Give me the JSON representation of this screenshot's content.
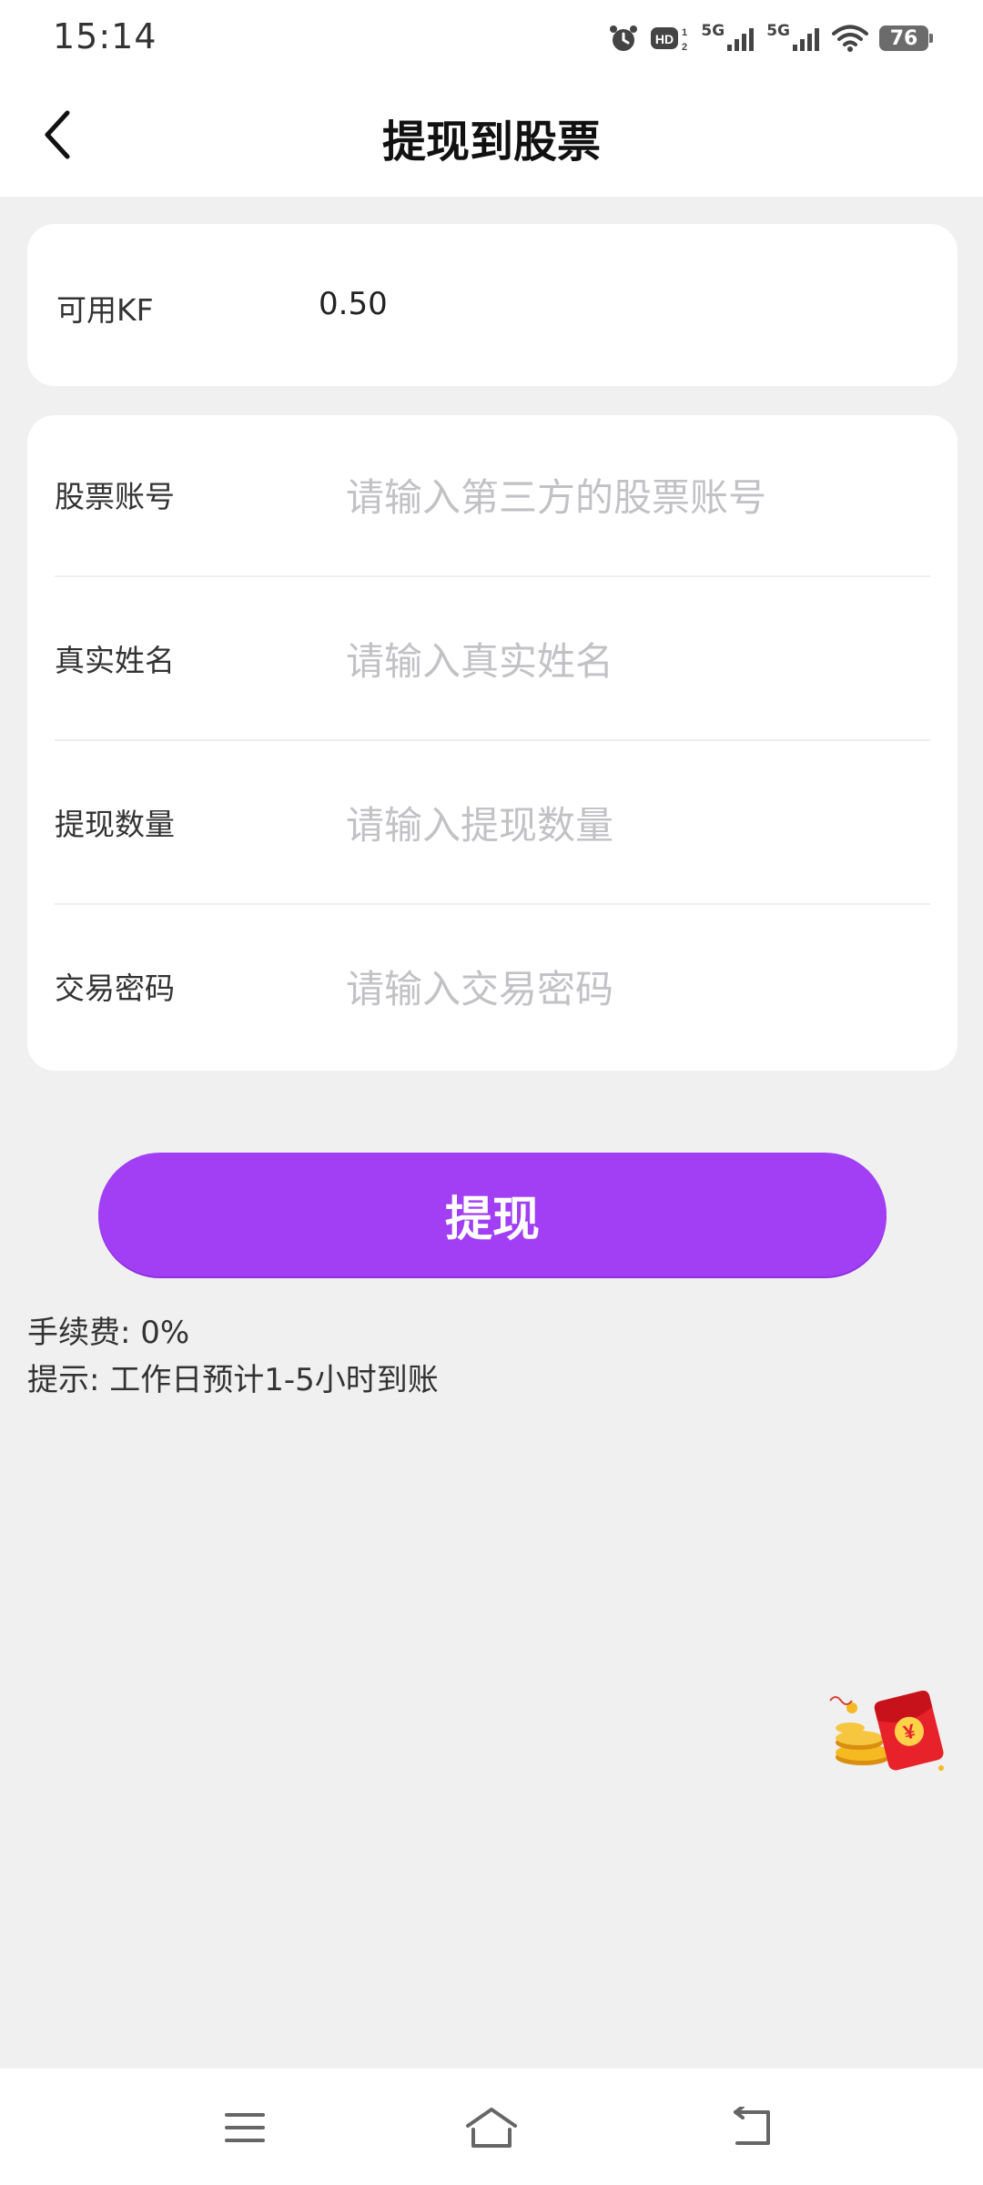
{
  "status_bar": {
    "time": "15:14",
    "icons": [
      "alarm-icon",
      "hd-call-icon",
      "signal-5g-icon",
      "signal-5g-icon",
      "wifi-icon"
    ],
    "signal_label_1": "5G",
    "signal_label_2": "5G",
    "battery_level": "76"
  },
  "header": {
    "back_icon": "chevron-left-icon",
    "title": "提现到股票"
  },
  "balance": {
    "label": "可用KF",
    "value": "0.50"
  },
  "form": {
    "fields": [
      {
        "label": "股票账号",
        "placeholder": "请输入第三方的股票账号",
        "value": ""
      },
      {
        "label": "真实姓名",
        "placeholder": "请输入真实姓名",
        "value": ""
      },
      {
        "label": "提现数量",
        "placeholder": "请输入提现数量",
        "value": ""
      },
      {
        "label": "交易密码",
        "placeholder": "请输入交易密码",
        "value": ""
      }
    ]
  },
  "submit": {
    "label": "提现"
  },
  "info": {
    "fee": "手续费: 0%",
    "tip": "提示: 工作日预计1-5小时到账"
  },
  "floating": {
    "icon": "red-packet-icon"
  },
  "system_nav": {
    "icons": [
      "menu-icon",
      "home-icon",
      "back-icon"
    ]
  },
  "colors": {
    "accent": "#a23ff5",
    "background": "#f0f0f0",
    "card": "#ffffff",
    "placeholder": "#c2c2c6"
  }
}
